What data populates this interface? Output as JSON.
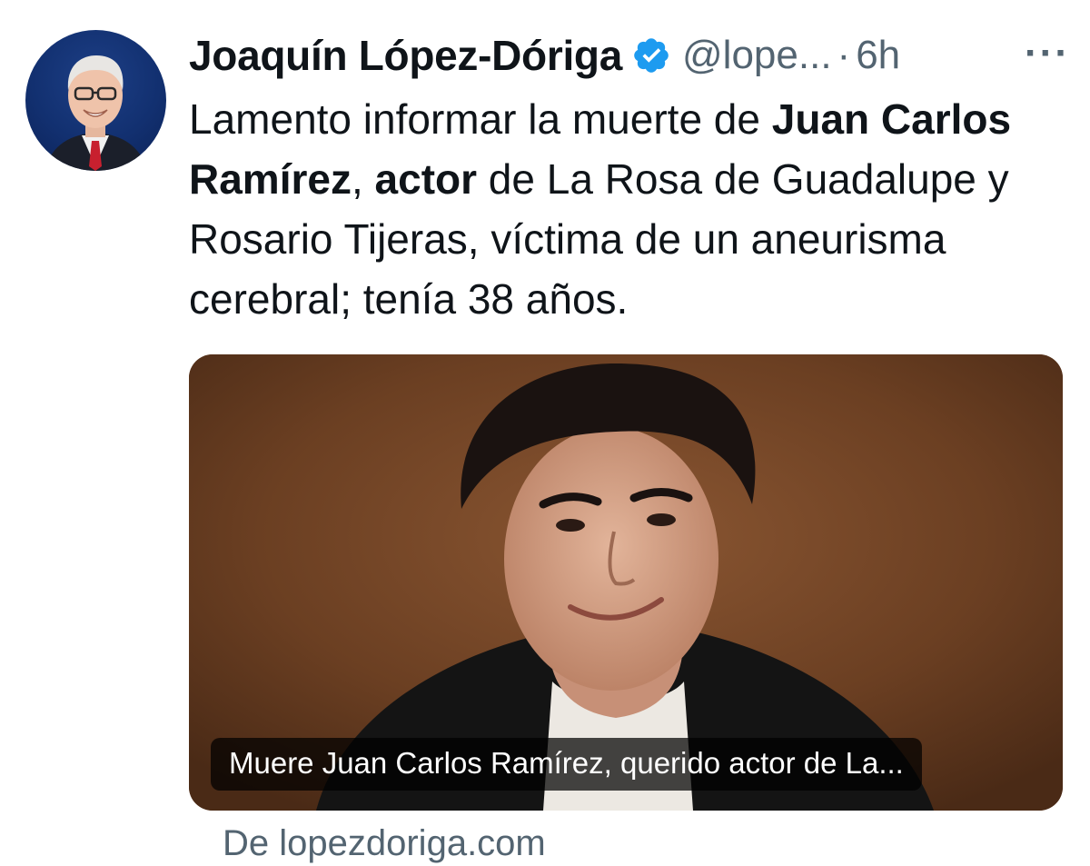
{
  "tweet": {
    "author": {
      "display_name": "Joaquín López-Dóriga",
      "handle": "@lope...",
      "verified": true,
      "avatar_icon": "avatar-photo"
    },
    "separator": "·",
    "time": "6h",
    "more_label": "···",
    "text_segments": [
      {
        "text": "Lamento informar la muerte de ",
        "bold": false
      },
      {
        "text": "Juan Carlos Ramírez",
        "bold": true
      },
      {
        "text": ", ",
        "bold": false
      },
      {
        "text": "actor",
        "bold": true
      },
      {
        "text": " de La Rosa de Guadalupe y Rosario Tijeras, víctima de un aneurisma cerebral; tenía 38 años.",
        "bold": false
      }
    ],
    "card": {
      "caption": "Muere Juan Carlos Ramírez, querido actor de La...",
      "source": "De lopezdoriga.com"
    }
  },
  "colors": {
    "text_primary": "#0f1419",
    "text_secondary": "#536471",
    "verified_blue": "#1d9bf0",
    "card_background": "#6b3f22"
  }
}
